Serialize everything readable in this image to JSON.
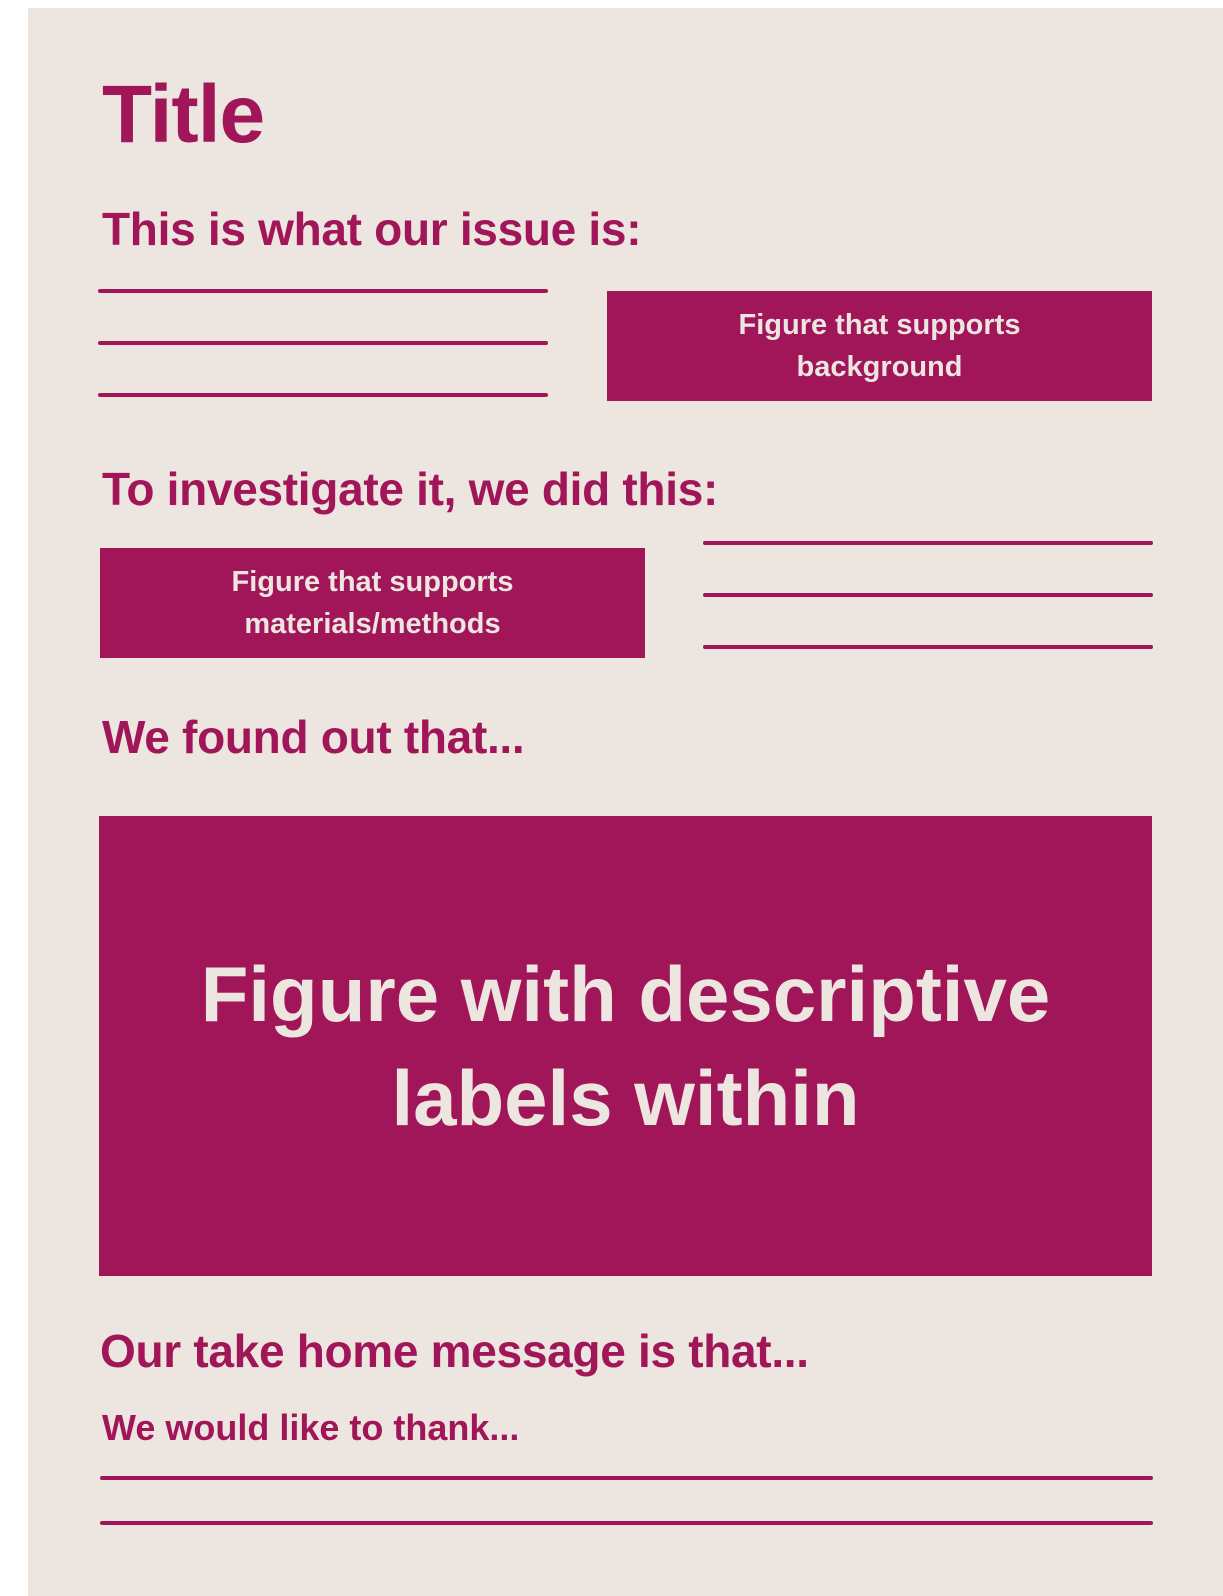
{
  "poster": {
    "title": "Title",
    "sections": {
      "issue": "This is what our issue is:",
      "investigate": "To investigate it, we did this:",
      "found": "We found out that...",
      "take_home": "Our take home message is that...",
      "thanks": "We would like to thank..."
    },
    "figures": {
      "background": "Figure that supports\nbackground",
      "methods": "Figure that supports\nmaterials/methods",
      "results": "Figure with descriptive\nlabels within"
    },
    "colors": {
      "accent": "#a01658",
      "background": "#ede5df"
    }
  }
}
